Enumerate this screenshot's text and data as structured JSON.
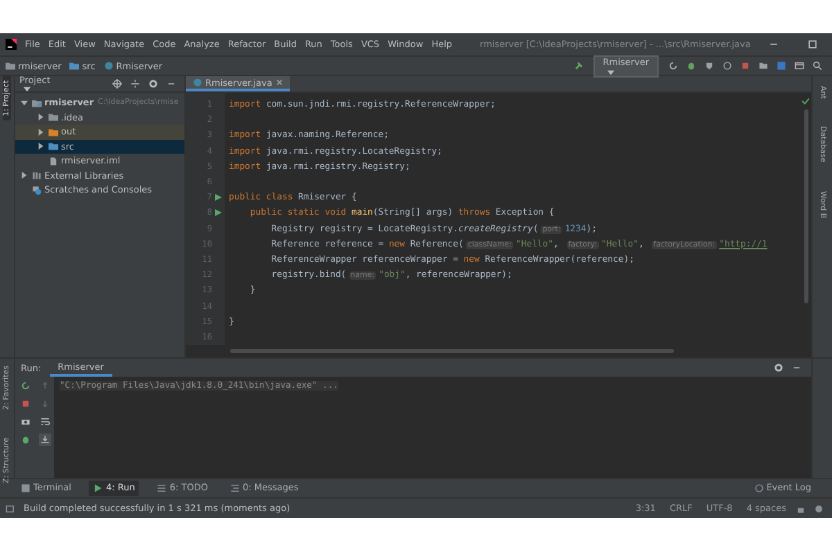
{
  "menu_bar": {
    "items": [
      "File",
      "Edit",
      "View",
      "Navigate",
      "Code",
      "Analyze",
      "Refactor",
      "Build",
      "Run",
      "Tools",
      "VCS",
      "Window",
      "Help"
    ],
    "title": "rmiserver [C:\\IdeaProjects\\rmiserver] - ...\\src\\Rmiserver.java"
  },
  "navigation_bar": {
    "breadcrumbs": [
      {
        "label": "rmiserver",
        "kind": "module"
      },
      {
        "label": "src",
        "kind": "folder"
      },
      {
        "label": "Rmiserver",
        "kind": "class"
      }
    ],
    "run_configuration": "Rmiserver"
  },
  "left_stripe": [
    "1: Project",
    "2: Favorites",
    "Z: Structure"
  ],
  "right_stripe": [
    "Ant",
    "Database",
    "Word B"
  ],
  "project_panel": {
    "title": "Project",
    "tree": [
      {
        "label": "rmiserver",
        "path": "C:\\IdeaProjects\\rmise",
        "kind": "module",
        "expanded": true,
        "selected": false,
        "children": [
          {
            "label": ".idea",
            "kind": "folder",
            "expanded": false,
            "selected": false
          },
          {
            "label": "out",
            "kind": "excluded",
            "expanded": false,
            "selected": false
          },
          {
            "label": "src",
            "kind": "source",
            "expanded": false,
            "selected": true
          },
          {
            "label": "rmiserver.iml",
            "kind": "file",
            "selected": false
          }
        ]
      },
      {
        "label": "External Libraries",
        "kind": "library",
        "expanded": false,
        "selected": false
      },
      {
        "label": "Scratches and Consoles",
        "kind": "scratches",
        "selected": false
      }
    ]
  },
  "editor": {
    "tab": "Rmiserver.java",
    "lines": [
      {
        "number": "1",
        "run": false,
        "segments": [
          {
            "kind": "kw",
            "text": "import "
          },
          {
            "kind": "plain",
            "text": "com.sun.jndi.rmi.registry.ReferenceWrapper;"
          }
        ]
      },
      {
        "number": "2",
        "run": false
      },
      {
        "number": "3",
        "run": false,
        "segments": [
          {
            "kind": "kw",
            "text": "import "
          },
          {
            "kind": "plain",
            "text": "javax.naming.Reference;"
          }
        ]
      },
      {
        "number": "4",
        "run": false,
        "segments": [
          {
            "kind": "kw",
            "text": "import "
          },
          {
            "kind": "plain",
            "text": "java.rmi.registry.LocateRegistry;"
          }
        ]
      },
      {
        "number": "5",
        "run": false,
        "segments": [
          {
            "kind": "kw",
            "text": "import "
          },
          {
            "kind": "plain",
            "text": "java.rmi.registry.Registry;"
          }
        ]
      },
      {
        "number": "6",
        "run": false
      },
      {
        "number": "7",
        "run": true,
        "segments": [
          {
            "kind": "kw",
            "text": "public class "
          },
          {
            "kind": "plain",
            "text": "Rmiserver {"
          }
        ]
      },
      {
        "number": "8",
        "run": true,
        "segments": [
          {
            "kind": "kw",
            "text": "    public static void "
          },
          {
            "kind": "method",
            "text": "main"
          },
          {
            "kind": "plain",
            "text": "(String[] args) "
          },
          {
            "kind": "kw",
            "text": "throws "
          },
          {
            "kind": "plain",
            "text": "Exception {"
          }
        ]
      },
      {
        "number": "9",
        "run": false,
        "segments": [
          {
            "kind": "plain",
            "text": "        Registry registry = LocateRegistry."
          },
          {
            "kind": "static",
            "text": "createRegistry"
          },
          {
            "kind": "plain",
            "text": "("
          },
          {
            "kind": "hint",
            "text": "port:"
          },
          {
            "kind": "number",
            "text": "1234"
          },
          {
            "kind": "plain",
            "text": ");"
          }
        ]
      },
      {
        "number": "10",
        "run": false,
        "segments": [
          {
            "kind": "plain",
            "text": "        Reference reference = "
          },
          {
            "kind": "kw",
            "text": "new "
          },
          {
            "kind": "plain",
            "text": "Reference("
          },
          {
            "kind": "hint",
            "text": "className:"
          },
          {
            "kind": "str",
            "text": "\"Hello\""
          },
          {
            "kind": "plain",
            "text": ", "
          },
          {
            "kind": "hint",
            "text": "factory:"
          },
          {
            "kind": "str",
            "text": "\"Hello\""
          },
          {
            "kind": "plain",
            "text": ", "
          },
          {
            "kind": "hint",
            "text": "factoryLocation:"
          },
          {
            "kind": "link",
            "text": "\"http://1"
          }
        ]
      },
      {
        "number": "11",
        "run": false,
        "segments": [
          {
            "kind": "plain",
            "text": "        ReferenceWrapper referenceWrapper = "
          },
          {
            "kind": "kw",
            "text": "new "
          },
          {
            "kind": "plain",
            "text": "ReferenceWrapper(reference);"
          }
        ]
      },
      {
        "number": "12",
        "run": false,
        "segments": [
          {
            "kind": "plain",
            "text": "        registry.bind("
          },
          {
            "kind": "hint",
            "text": "name:"
          },
          {
            "kind": "str",
            "text": "\"obj\""
          },
          {
            "kind": "plain",
            "text": ", referenceWrapper);"
          }
        ]
      },
      {
        "number": "13",
        "run": false,
        "segments": [
          {
            "kind": "plain",
            "text": "    }"
          }
        ]
      },
      {
        "number": "14",
        "run": false
      },
      {
        "number": "15",
        "run": false,
        "segments": [
          {
            "kind": "plain",
            "text": "}"
          }
        ]
      },
      {
        "number": "16",
        "run": false
      }
    ]
  },
  "run_panel": {
    "title": "Run:",
    "tab": "Rmiserver",
    "console": "\"C:\\Program Files\\Java\\jdk1.8.0_241\\bin\\java.exe\" ..."
  },
  "tool_tabs": [
    {
      "label": "Terminal",
      "kind": "terminal",
      "selected": false
    },
    {
      "label": "4: Run",
      "kind": "run",
      "selected": true
    },
    {
      "label": "6: TODO",
      "kind": "todo",
      "selected": false
    },
    {
      "label": "0: Messages",
      "kind": "messages",
      "selected": false
    }
  ],
  "event_log": "Event Log",
  "status_bar": {
    "message": "Build completed successfully in 1 s 321 ms (moments ago)",
    "items": [
      "3:31",
      "CRLF",
      "UTF-8",
      "4 spaces"
    ]
  }
}
